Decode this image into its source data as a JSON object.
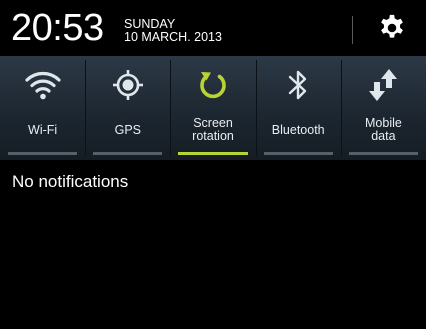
{
  "status": {
    "time": "20:53",
    "day": "SUNDAY",
    "date": "10 MARCH. 2013"
  },
  "settings": {
    "icon": "gear-icon"
  },
  "toggles": [
    {
      "label": "Wi-Fi",
      "icon": "wifi-icon",
      "active": false
    },
    {
      "label": "GPS",
      "icon": "gps-icon",
      "active": false
    },
    {
      "label": "Screen\nrotation",
      "icon": "screen-rotation-icon",
      "active": true
    },
    {
      "label": "Bluetooth",
      "icon": "bluetooth-icon",
      "active": false
    },
    {
      "label": "Mobile\ndata",
      "icon": "mobile-data-icon",
      "active": false
    }
  ],
  "notifications": {
    "empty_text": "No notifications"
  },
  "colors": {
    "active_indicator": "#b7d433",
    "inactive_indicator": "#56606a",
    "icon": "#dfe7ec",
    "active_icon": "#b7d433"
  }
}
